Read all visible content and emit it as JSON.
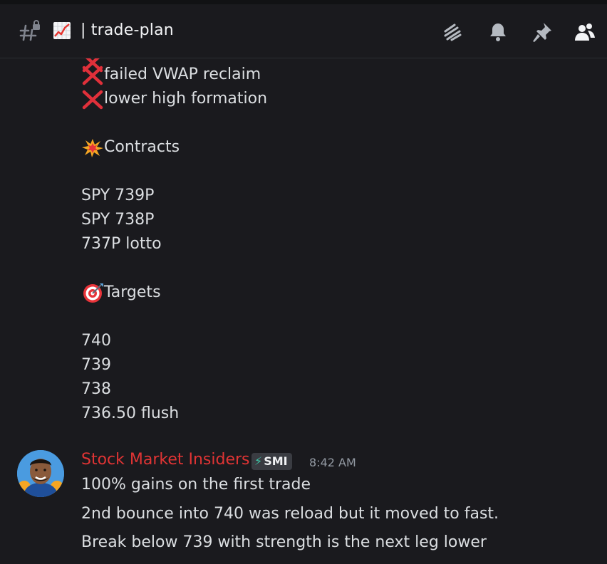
{
  "header": {
    "channel_emoji": "chart-increasing-icon",
    "title": "| trade-plan",
    "icons": [
      "threads-icon",
      "bell-icon",
      "pin-icon",
      "members-icon"
    ]
  },
  "message_top": {
    "bullets": [
      "failed VWAP reclaim",
      "lower high formation"
    ],
    "contracts_heading": "Contracts",
    "contracts": [
      "SPY 739P",
      "SPY 738P",
      "737P lotto"
    ],
    "targets_heading": "Targets",
    "targets": [
      "740",
      "739",
      "738",
      "736.50 flush"
    ]
  },
  "message": {
    "author": "Stock Market Insiders",
    "badge": "SMI",
    "badge_symbol": "⚡",
    "time": "8:42 AM",
    "lines": [
      "100% gains on the first trade",
      "2nd bounce into 740 was reload but it moved to fast.",
      "Break below 739 with strength is the next leg lower"
    ]
  },
  "colors": {
    "background": "#1a1a1e",
    "text": "#dbdee1",
    "author": "#e03434",
    "badge_bg": "#3a3c42",
    "timestamp": "#949ba4"
  }
}
